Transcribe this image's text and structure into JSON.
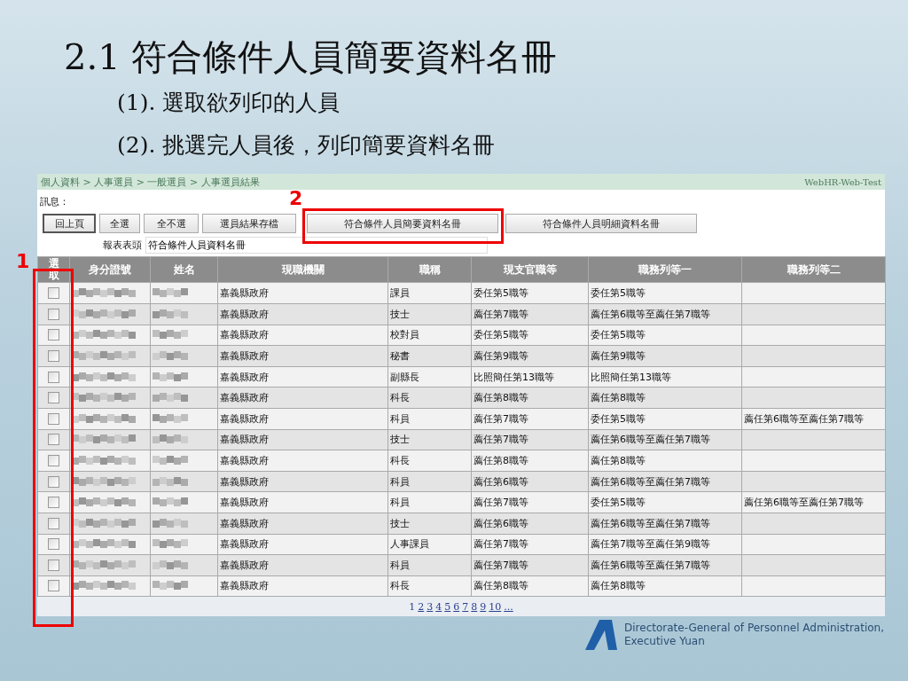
{
  "slide": {
    "title": "2.1 符合條件人員簡要資料名冊",
    "steps": [
      "(1). 選取欲列印的人員",
      "(2). 挑選完人員後，列印簡要資料名冊"
    ]
  },
  "screen": {
    "breadcrumb": "個人資料 > 人事選員 > 一般選員 > 人事選員結果",
    "system_name": "WebHR-Web-Test",
    "message_label": "訊息：",
    "buttons": [
      {
        "label": "回上頁",
        "default": true
      },
      {
        "label": "全選",
        "default": false
      },
      {
        "label": "全不選",
        "default": false
      },
      {
        "label": "選員結果存檔",
        "default": false
      },
      {
        "label": "符合條件人員簡要資料名冊",
        "default": false,
        "annotation": "2"
      },
      {
        "label": "符合條件人員明細資料名冊",
        "default": false
      }
    ],
    "report_header": {
      "label": "報表表頭",
      "value": "符合條件人員資料名冊"
    },
    "table": {
      "columns": [
        "選取",
        "身分證號",
        "姓名",
        "現職機關",
        "職稱",
        "現支官職等",
        "職務列等一",
        "職務列等二"
      ],
      "rows": [
        {
          "checked": false,
          "agency": "嘉義縣政府",
          "title": "課員",
          "grade": "委任第5職等",
          "rank_1": "委任第5職等"
        },
        {
          "checked": false,
          "agency": "嘉義縣政府",
          "title": "技士",
          "grade": "薦任第7職等",
          "rank_1": "薦任第6職等至薦任第7職等"
        },
        {
          "checked": false,
          "agency": "嘉義縣政府",
          "title": "校對員",
          "grade": "委任第5職等",
          "rank_1": "委任第5職等"
        },
        {
          "checked": false,
          "agency": "嘉義縣政府",
          "title": "秘書",
          "grade": "薦任第9職等",
          "rank_1": "薦任第9職等"
        },
        {
          "checked": false,
          "agency": "嘉義縣政府",
          "title": "副縣長",
          "grade": "比照簡任第13職等",
          "rank_1": "比照簡任第13職等"
        },
        {
          "checked": false,
          "agency": "嘉義縣政府",
          "title": "科長",
          "grade": "薦任第8職等",
          "rank_1": "薦任第8職等"
        },
        {
          "checked": false,
          "agency": "嘉義縣政府",
          "title": "科員",
          "grade": "薦任第7職等",
          "rank_1": "委任第5職等",
          "rank_2": "薦任第6職等至薦任第7職等"
        },
        {
          "checked": false,
          "agency": "嘉義縣政府",
          "title": "技士",
          "grade": "薦任第7職等",
          "rank_1": "薦任第6職等至薦任第7職等"
        },
        {
          "checked": false,
          "agency": "嘉義縣政府",
          "title": "科長",
          "grade": "薦任第8職等",
          "rank_1": "薦任第8職等"
        },
        {
          "checked": false,
          "agency": "嘉義縣政府",
          "title": "科員",
          "grade": "薦任第6職等",
          "rank_1": "薦任第6職等至薦任第7職等"
        },
        {
          "checked": false,
          "agency": "嘉義縣政府",
          "title": "科員",
          "grade": "薦任第7職等",
          "rank_1": "委任第5職等",
          "rank_2": "薦任第6職等至薦任第7職等"
        },
        {
          "checked": false,
          "agency": "嘉義縣政府",
          "title": "技士",
          "grade": "薦任第6職等",
          "rank_1": "薦任第6職等至薦任第7職等"
        },
        {
          "checked": false,
          "agency": "嘉義縣政府",
          "title": "人事課員",
          "grade": "薦任第7職等",
          "rank_1": "薦任第7職等至薦任第9職等"
        },
        {
          "checked": false,
          "agency": "嘉義縣政府",
          "title": "科員",
          "grade": "薦任第7職等",
          "rank_1": "薦任第6職等至薦任第7職等"
        },
        {
          "checked": false,
          "agency": "嘉義縣政府",
          "title": "科長",
          "grade": "薦任第8職等",
          "rank_1": "薦任第8職等"
        }
      ]
    },
    "pages": [
      {
        "label": "1",
        "selected": true
      },
      {
        "label": "2",
        "selected": false
      },
      {
        "label": "3",
        "selected": false
      },
      {
        "label": "4",
        "selected": false
      },
      {
        "label": "5",
        "selected": false
      },
      {
        "label": "6",
        "selected": false
      },
      {
        "label": "7",
        "selected": false
      },
      {
        "label": "8",
        "selected": false
      },
      {
        "label": "9",
        "selected": false
      },
      {
        "label": "10",
        "selected": false
      },
      {
        "label": "...",
        "selected": false
      }
    ]
  },
  "annotations": [
    {
      "label": "1"
    }
  ],
  "logo": {
    "lines": [
      "Directorate-General of Personnel Administration,",
      "Executive Yuan"
    ]
  }
}
